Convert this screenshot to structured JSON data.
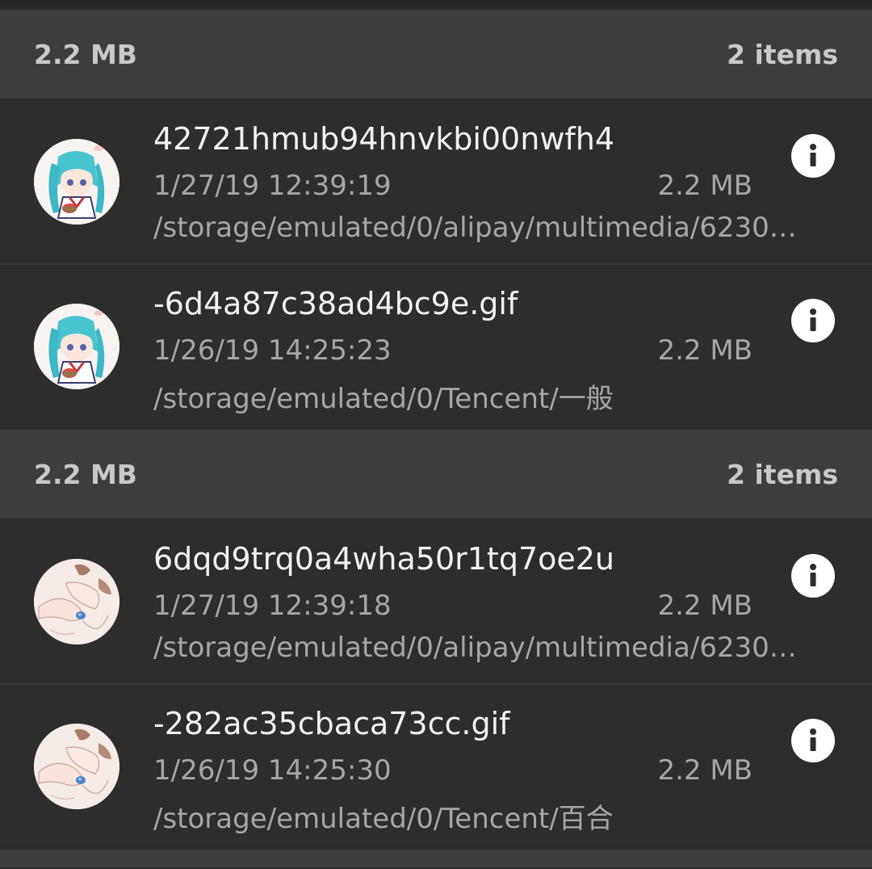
{
  "groups": [
    {
      "size": "2.2 MB",
      "count": "2 items",
      "items": [
        {
          "name": "42721hmub94hnvkbi00nwfh4",
          "date": "1/27/19 12:39:19",
          "size": "2.2 MB",
          "path": "/storage/emulated/0/alipay/multimedia/6230…",
          "thumbnail": "anime-girl-teal-hair"
        },
        {
          "name": "-6d4a87c38ad4bc9e.gif",
          "date": "1/26/19 14:25:23",
          "size": "2.2 MB",
          "path": "/storage/emulated/0/Tencent/一般",
          "thumbnail": "anime-girl-teal-hair"
        }
      ]
    },
    {
      "size": "2.2 MB",
      "count": "2 items",
      "items": [
        {
          "name": "6dqd9trq0a4wha50r1tq7oe2u",
          "date": "1/27/19 12:39:18",
          "size": "2.2 MB",
          "path": "/storage/emulated/0/alipay/multimedia/6230…",
          "thumbnail": "sketch-hands-blue-bead"
        },
        {
          "name": "-282ac35cbaca73cc.gif",
          "date": "1/26/19 14:25:30",
          "size": "2.2 MB",
          "path": "/storage/emulated/0/Tencent/百合",
          "thumbnail": "sketch-hands-blue-bead"
        }
      ]
    }
  ],
  "icons": {
    "info": "info-icon"
  },
  "colors": {
    "background": "#2b2b2b",
    "header_background": "#3d3d3d",
    "primary_text": "#f2f2f2",
    "secondary_text": "#a7a7a7",
    "header_text": "#c9c9c9"
  }
}
